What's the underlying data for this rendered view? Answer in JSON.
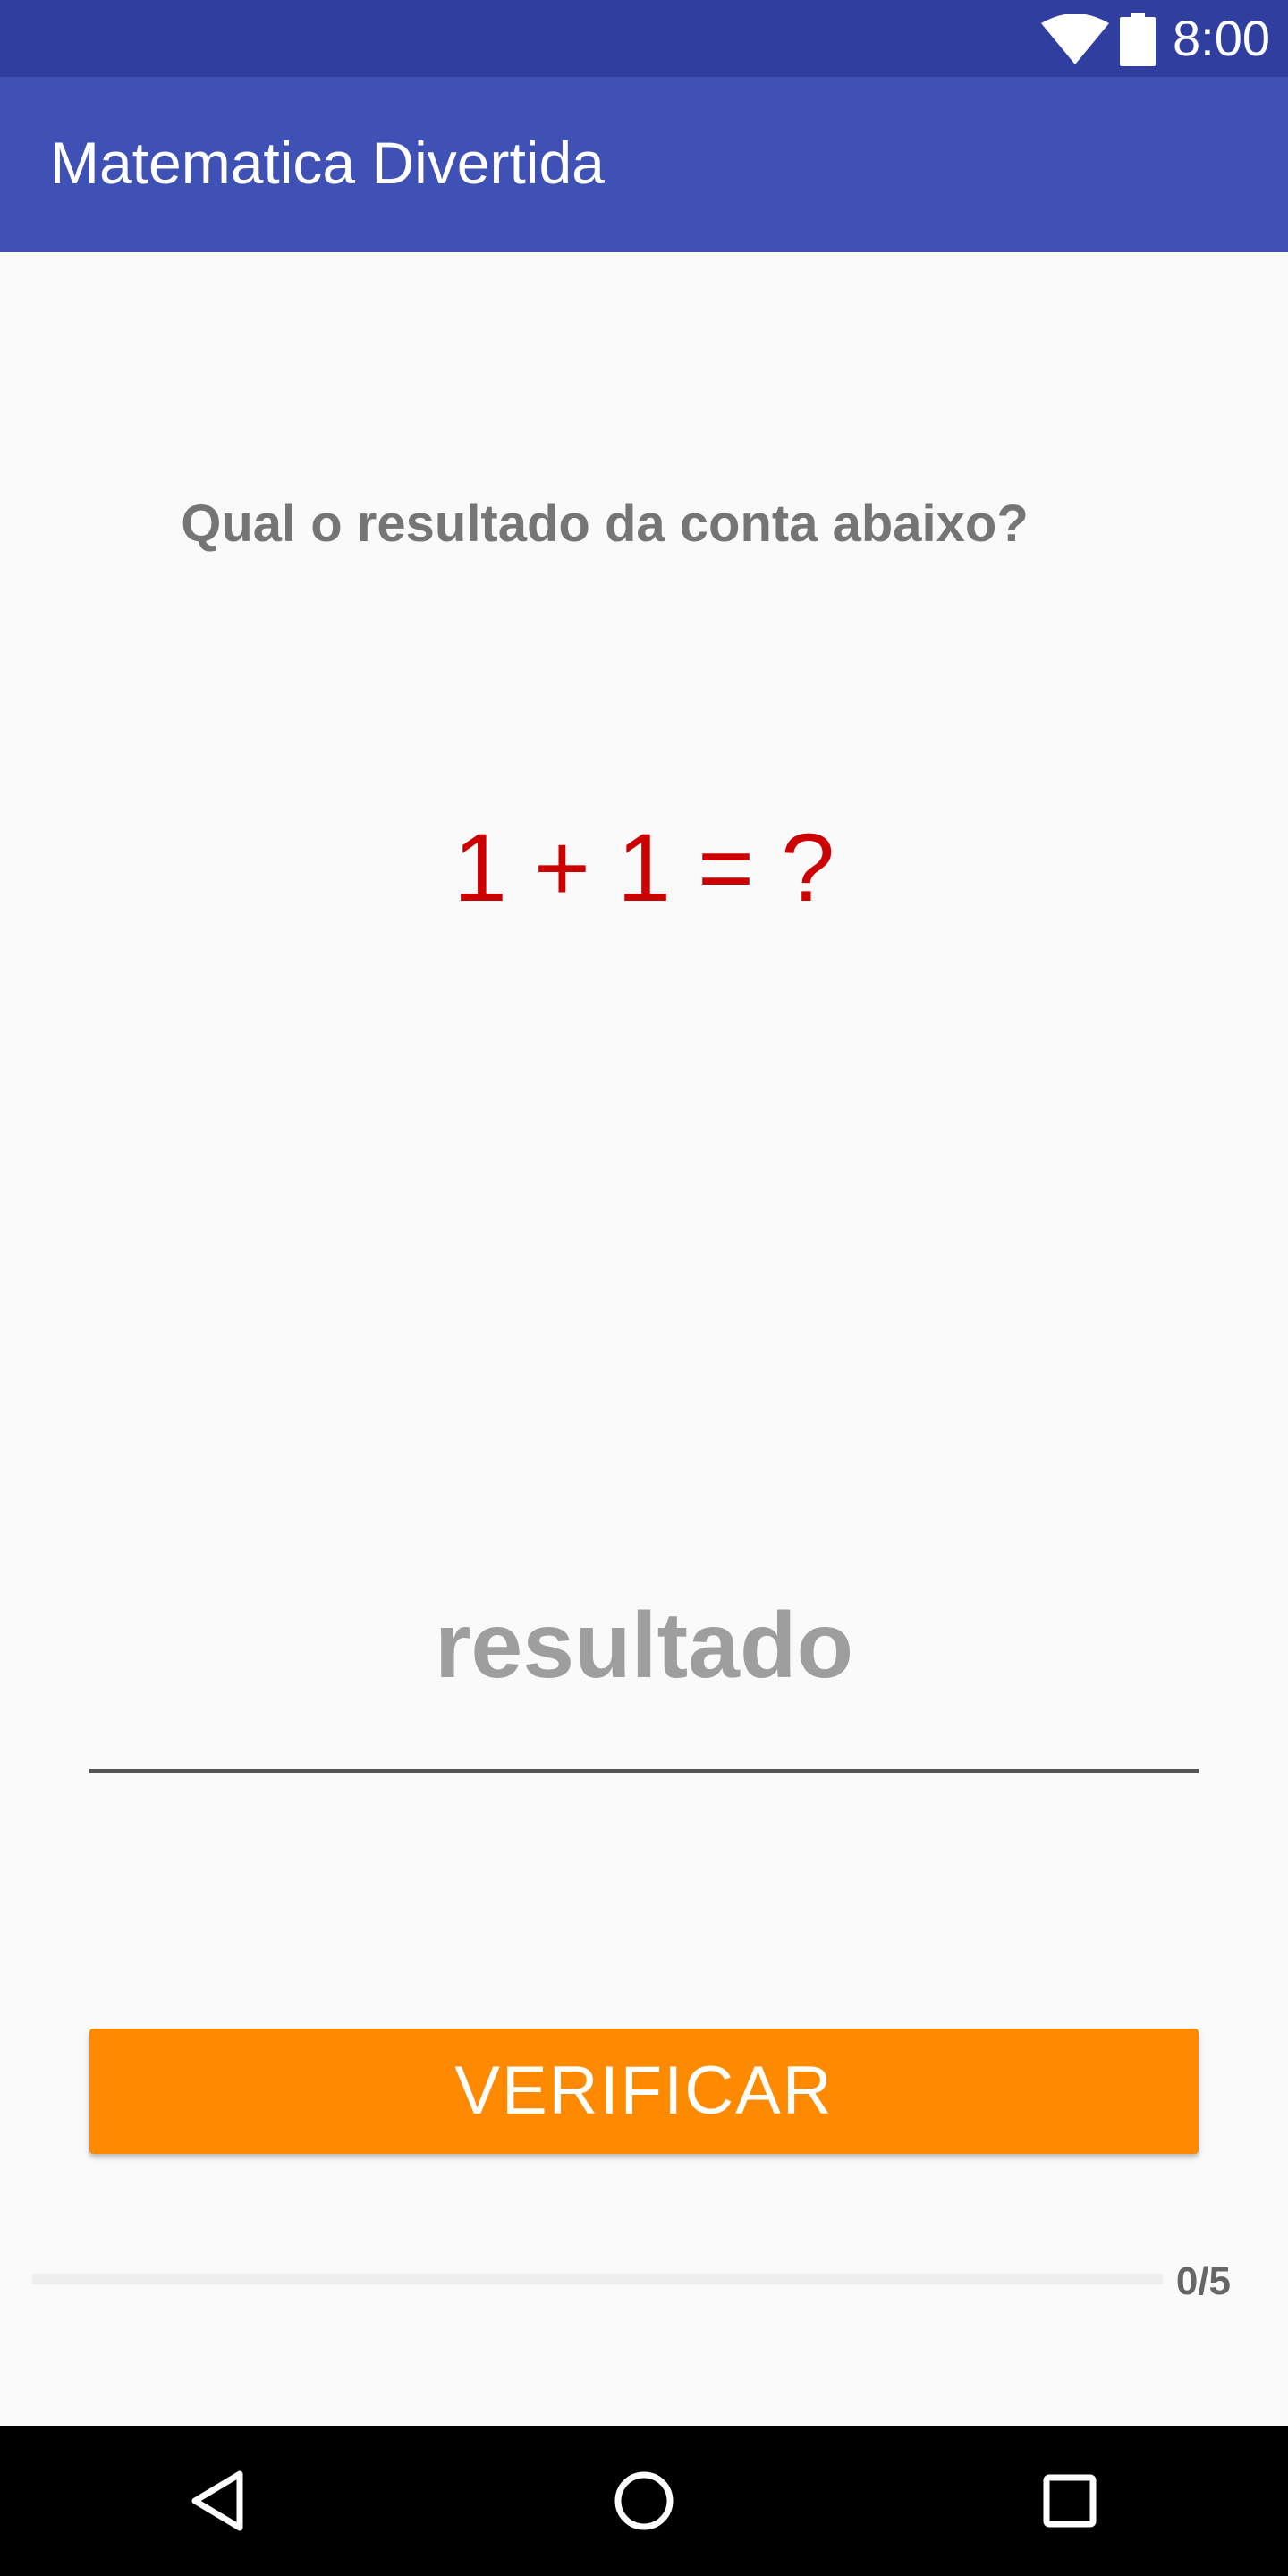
{
  "status_bar": {
    "time": "8:00",
    "icons": [
      "wifi-icon",
      "battery-icon"
    ]
  },
  "app_bar": {
    "title": "Matematica Divertida"
  },
  "quiz": {
    "question": "Qual o resultado da conta abaixo?",
    "equation": "1 + 1 = ?",
    "answer_input": {
      "value": "",
      "placeholder": "resultado"
    },
    "verify_button_label": "VERIFICAR"
  },
  "progress": {
    "current": 0,
    "total": 5,
    "fraction": 0,
    "label": "0/5"
  },
  "nav_bar": {
    "icons": [
      "back-icon",
      "home-icon",
      "recents-icon"
    ]
  },
  "colors": {
    "status_bar": "#303f9f",
    "app_bar": "#3f51b5",
    "equation": "#cc0000",
    "button": "#ff8a00",
    "background": "#fafafa"
  }
}
